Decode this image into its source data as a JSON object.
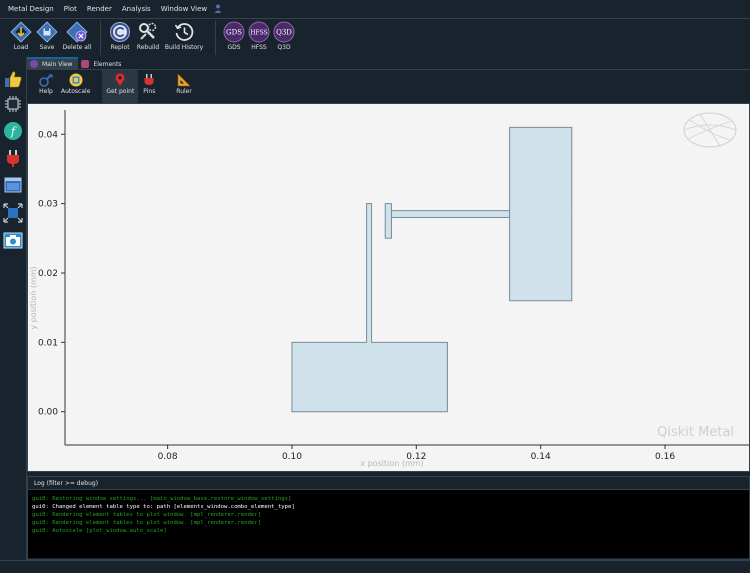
{
  "menubar": {
    "items": [
      "Metal Design",
      "Plot",
      "Render",
      "Analysis",
      "Window View"
    ]
  },
  "toolbar": {
    "file_buttons": [
      {
        "label": "Load",
        "icon": "load-icon"
      },
      {
        "label": "Save",
        "icon": "save-icon"
      },
      {
        "label": "Delete all",
        "icon": "delete-all-icon"
      }
    ],
    "action_buttons": [
      {
        "label": "Replot",
        "icon": "replot-icon"
      },
      {
        "label": "Rebuild",
        "icon": "rebuild-icon"
      },
      {
        "label": "Build History",
        "icon": "history-icon"
      }
    ],
    "renderer_buttons": [
      {
        "label": "GDS",
        "badge": "GDS"
      },
      {
        "label": "HFSS",
        "badge": "HFSS"
      },
      {
        "label": "Q3D",
        "badge": "Q3D"
      }
    ]
  },
  "tabs": [
    {
      "label": "Main View",
      "active": true
    },
    {
      "label": "Elements",
      "active": false
    }
  ],
  "plot_toolbar": [
    {
      "label": "Help",
      "icon": "help-icon"
    },
    {
      "label": "Autoscale",
      "icon": "autoscale-icon"
    },
    {
      "label": "Get point",
      "icon": "get-point-icon",
      "active": true
    },
    {
      "label": "Pins",
      "icon": "pins-icon"
    },
    {
      "label": "Ruler",
      "icon": "ruler-icon"
    }
  ],
  "left_toolbar": [
    {
      "icon": "thumbs-up-icon"
    },
    {
      "icon": "chip-icon"
    },
    {
      "icon": "function-icon"
    },
    {
      "icon": "plug-icon"
    },
    {
      "icon": "window-icon"
    },
    {
      "icon": "fit-icon"
    },
    {
      "icon": "screenshot-icon"
    }
  ],
  "chart_data": {
    "type": "scatter",
    "xlabel": "x position (mm)",
    "ylabel": "y position (mm)",
    "xlim": [
      0.0635,
      0.1735
    ],
    "ylim": [
      -0.0048,
      0.0435
    ],
    "xticks": [
      0.08,
      0.1,
      0.12,
      0.14,
      0.16
    ],
    "yticks": [
      0.0,
      0.01,
      0.02,
      0.03,
      0.04
    ],
    "xtick_labels": [
      "0.08",
      "0.10",
      "0.12",
      "0.14",
      "0.16"
    ],
    "ytick_labels": [
      "0.00",
      "0.01",
      "0.02",
      "0.03",
      "0.04"
    ],
    "shapes": [
      {
        "name": "lower-pad",
        "polygon": [
          [
            0.1,
            0.0
          ],
          [
            0.125,
            0.0
          ],
          [
            0.125,
            0.01
          ],
          [
            0.1128,
            0.01
          ],
          [
            0.1128,
            0.03
          ],
          [
            0.112,
            0.03
          ],
          [
            0.112,
            0.01
          ],
          [
            0.1,
            0.01
          ]
        ]
      },
      {
        "name": "upper-pad",
        "polygon": [
          [
            0.115,
            0.025
          ],
          [
            0.116,
            0.025
          ],
          [
            0.116,
            0.029
          ],
          [
            0.135,
            0.029
          ],
          [
            0.135,
            0.016
          ],
          [
            0.145,
            0.016
          ],
          [
            0.145,
            0.041
          ],
          [
            0.135,
            0.041
          ],
          [
            0.135,
            0.028
          ],
          [
            0.116,
            0.028
          ],
          [
            0.116,
            0.03
          ],
          [
            0.115,
            0.03
          ]
        ]
      }
    ],
    "fill_color": "#cfe1eb",
    "edge_color": "#7b8b96",
    "watermark": "Qiskit Metal"
  },
  "log": {
    "header": "Log  (filter >= debug)",
    "lines": [
      {
        "text": "gui0: Restoring window settings... [main_window_base.restore_window_settings]",
        "color": "#1ea51e"
      },
      {
        "text": "gui0: Changed element table type to: path [elements_window.combo_element_type]",
        "color": "#ffffff"
      },
      {
        "text": "gui0: Rendering element tables to plot window. [mpl_renderer.render]",
        "color": "#1ea51e"
      },
      {
        "text": "gui0: Rendering element tables to plot window. [mpl_renderer.render]",
        "color": "#1ea51e"
      },
      {
        "text": "gui0: Autoscale [plot_window.auto_scale]",
        "color": "#1ea51e"
      }
    ]
  },
  "colors": {
    "background": "#19232d",
    "border": "#32414b",
    "accent": "#1464a0",
    "renderer_badge": "#4a2a6a"
  }
}
